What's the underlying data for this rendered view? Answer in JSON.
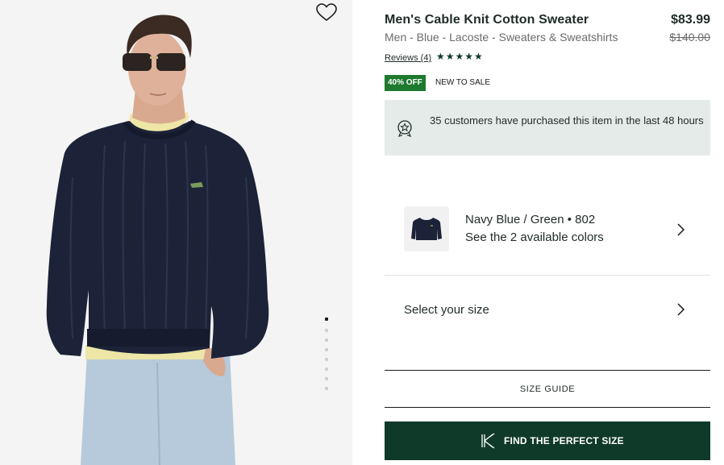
{
  "product": {
    "title": "Men's Cable Knit Cotton Sweater",
    "subtitle": "Men - Blue - Lacoste - Sweaters & Sweatshirts",
    "price": "$83.99",
    "old_price": "$140.00",
    "reviews_label": "Reviews (4)",
    "rating": 5,
    "rating_stars": "★★★★★",
    "discount_badge": "40% OFF",
    "sale_label": "NEW TO SALE"
  },
  "notice": {
    "text": "35 customers have purchased this item in the last 48 hours",
    "icon": "award-badge-icon"
  },
  "color_selector": {
    "name": "Navy Blue / Green • 802",
    "subtext": "See the 2 available colors"
  },
  "size_selector": {
    "label": "Select your size"
  },
  "size_guide": {
    "label": "SIZE GUIDE"
  },
  "find_size_button": {
    "label": "FIND THE PERFECT SIZE"
  },
  "gallery": {
    "image_count": 7,
    "active_index": 0
  },
  "colors": {
    "brand_dark_green": "#0f3a2a",
    "discount_green": "#1e7a2e",
    "info_box_bg": "#e5ebe8",
    "sweater_navy": "#1c2338"
  }
}
